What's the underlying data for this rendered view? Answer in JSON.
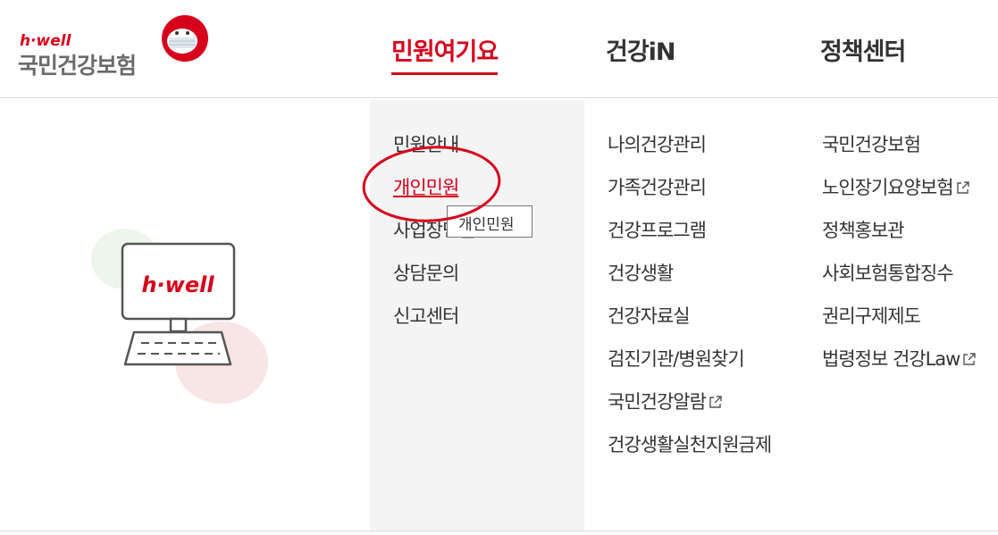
{
  "logo": {
    "tagline": "h·well",
    "name": "국민건강보험"
  },
  "nav": [
    {
      "label": "민원여기요",
      "active": true
    },
    {
      "label": "건강iN",
      "active": false
    },
    {
      "label": "정책센터",
      "active": false
    }
  ],
  "illustration": {
    "screen_text": "h·well"
  },
  "menu": {
    "col1": [
      "민원안내",
      "개인민원",
      "사업장민원",
      "상담문의",
      "신고센터"
    ],
    "col1_selected": "개인민원",
    "col2": [
      "나의건강관리",
      "가족건강관리",
      "건강프로그램",
      "건강생활",
      "건강자료실",
      "검진기관/병원찾기",
      "국민건강알람",
      "건강생활실천지원금제"
    ],
    "col3": [
      "국민건강보험",
      "노인장기요양보험",
      "정책홍보관",
      "사회보험통합징수",
      "권리구제제도",
      "법령정보 건강Law"
    ]
  },
  "external_link_icon": "external-link-icon",
  "tooltip": {
    "text": "개인민원"
  },
  "colors": {
    "brand_red": "#d6001c",
    "menu_bg": "#f4f4f4",
    "text": "#333333"
  }
}
